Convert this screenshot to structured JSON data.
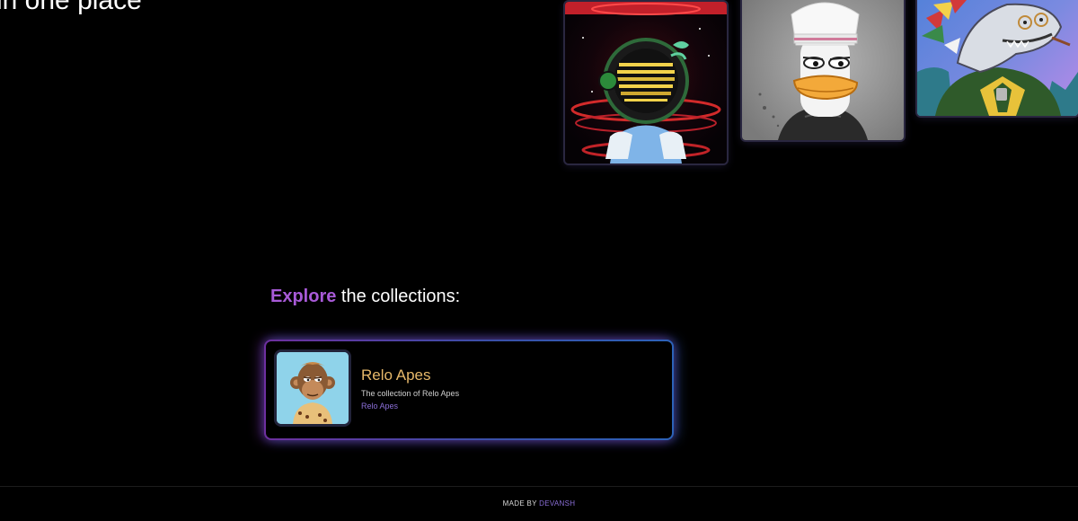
{
  "hero": {
    "title": "in one place"
  },
  "nfts": [
    {
      "name": "Headphone astronaut NFT",
      "icon": "astronaut-nft-image"
    },
    {
      "name": "Duck chef NFT",
      "icon": "duck-nft-image"
    },
    {
      "name": "Shark chief NFT",
      "icon": "shark-nft-image"
    }
  ],
  "explore": {
    "accent_word": "Explore",
    "rest": " the collections:"
  },
  "collections": [
    {
      "name": "Relo Apes",
      "description": "The collection of Relo Apes",
      "link_label": "Relo Apes",
      "icon": "ape-avatar-image"
    }
  ],
  "footer": {
    "prefix": "MADE BY ",
    "author": "DEVANSH"
  },
  "colors": {
    "background": "#000000",
    "accent_purple": "#a85ad8",
    "collection_name": "#e6b86a",
    "link": "#8b6fd8"
  }
}
